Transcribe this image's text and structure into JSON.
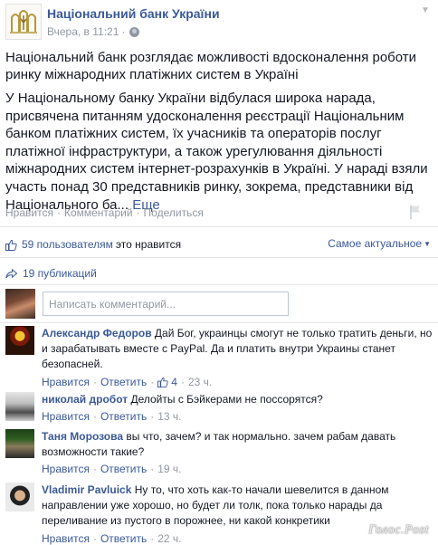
{
  "post": {
    "page_name": "Національний банк України",
    "time": "Вчера, в 11:21",
    "meta_separator": "·",
    "title": "Національний банк розглядає можливості вдосконалення роботи ринку міжнародних платіжних систем в Україні",
    "text": "У Національному банку України відбулася широка нарада, присвячена питанням удосконалення реєстрації Національним банком платіжних систем, їх учасників та операторів послуг платіжної інфраструктури, а також урегулювання діяльності міжнародних систем інтернет-розрахунків в Україні. У нараді взяли участь понад 30 представників ринку, зокрема, представники від Національного ба...",
    "more_label": "Еще"
  },
  "actions": {
    "like": "Нравится",
    "comment": "Комментарий",
    "share": "Поделиться",
    "separator": "·"
  },
  "likes": {
    "count_text": "59 пользователям",
    "rest_text": "это нравится",
    "sort_label": "Самое актуальное"
  },
  "shares": {
    "text": "19 публикаций"
  },
  "comment_box": {
    "placeholder": "Написать комментарий..."
  },
  "comments": [
    {
      "author": "Александр Федоров",
      "text": "Дай Бог, украинцы смогут не только тратить деньги, но и зарабатывать вместе с PayPal. Да и платить внутри Украины станет безопасней.",
      "like": "Нравится",
      "reply": "Ответить",
      "likes": "4",
      "time": "23 ч."
    },
    {
      "author": "николай дробот",
      "text": "Делойты с Бэйкерами не поссорятся?",
      "like": "Нравится",
      "reply": "Ответить",
      "time": "13 ч."
    },
    {
      "author": "Таня Морозова",
      "text": "вы что, зачем? и так нормально. зачем рабам давать возможности такие?",
      "like": "Нравится",
      "reply": "Ответить",
      "time": "19 ч."
    },
    {
      "author": "Vladimir Pavluick",
      "text": "Ну то, что хоть как-то начали шевелится в данном направлении уже хорошо, но будет ли толк, пока только нарады да переливание из пустого в порожнее, ни какой конкретики",
      "like": "Нравится",
      "reply": "Ответить",
      "time": "22 ч."
    }
  ],
  "watermark": "Голос.Post",
  "colors": {
    "link": "#3b5998",
    "meta": "#9197a3",
    "text": "#141823"
  }
}
